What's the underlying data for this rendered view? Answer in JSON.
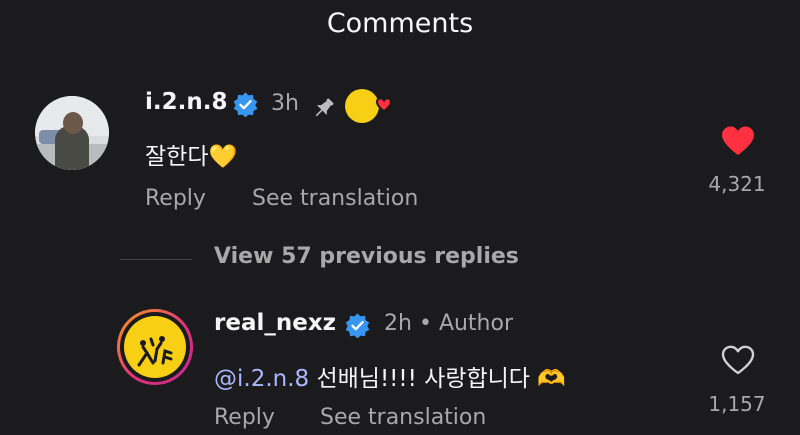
{
  "header": {
    "title": "Comments"
  },
  "comments": [
    {
      "username": "i.2.n.8",
      "time": "3h",
      "text": "잘한다",
      "text_emoji": "💛",
      "reply_label": "Reply",
      "translate_label": "See translation",
      "like_count": "4,321",
      "liked": true
    }
  ],
  "view_replies_label": "View 57 previous replies",
  "reply": {
    "username": "real_nexz",
    "time": "2h",
    "author_separator": "•",
    "author_label": "Author",
    "mention": "@i.2.n.8",
    "text": " 선배님!!!! 사랑합니다 ",
    "text_emoji": "🫶",
    "reply_label": "Reply",
    "translate_label": "See translation",
    "like_count": "1,157",
    "liked": false
  },
  "colors": {
    "background": "#1b1b1d",
    "verified": "#3797f0",
    "like_red": "#ff3040",
    "secondary_text": "#a8a8a8"
  }
}
